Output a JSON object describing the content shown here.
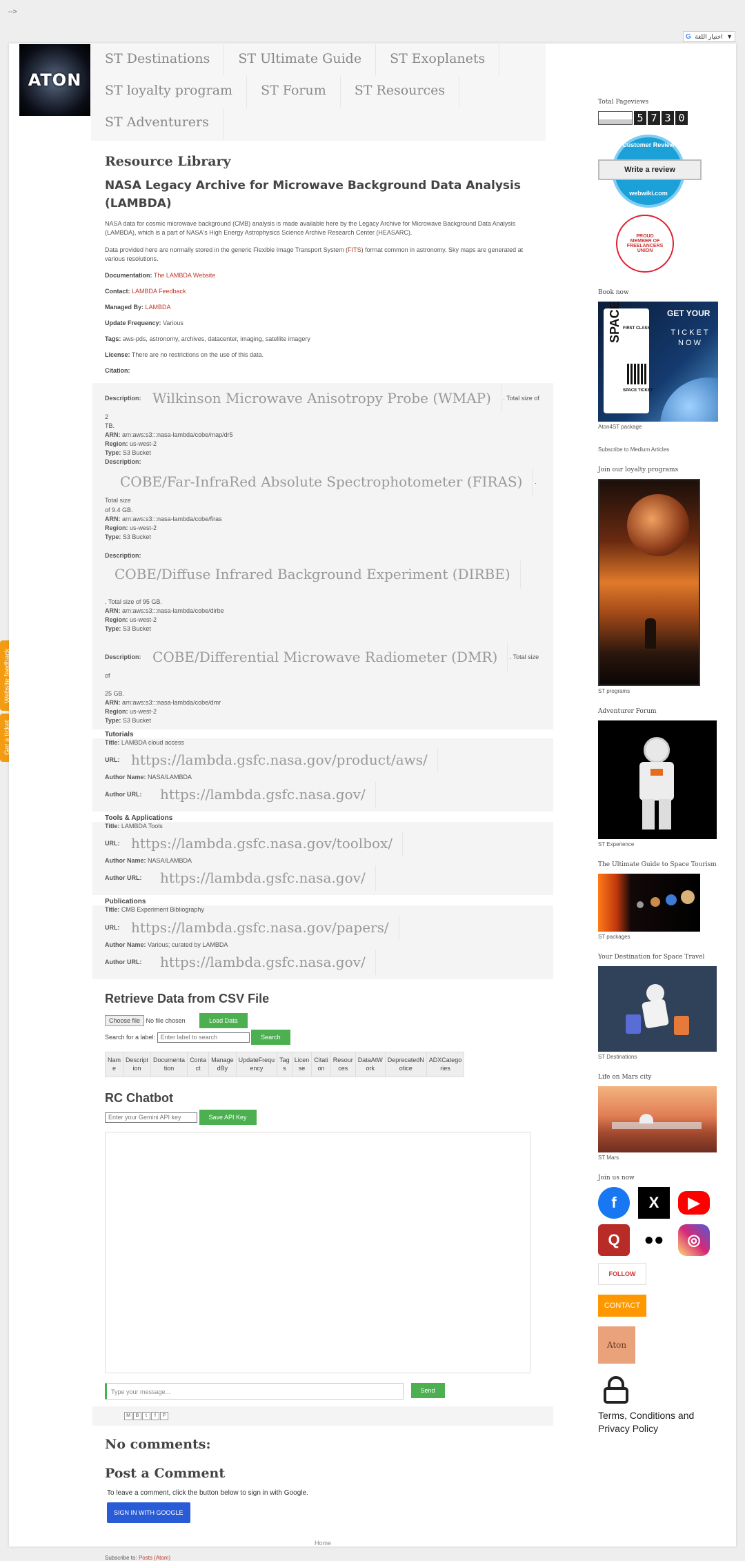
{
  "topbar": {
    "arrow": "-->",
    "translate_label": "اختيار اللغة",
    "translate_caret": "▼",
    "translate_g": "G"
  },
  "logo": {
    "text": "ATON"
  },
  "nav": [
    "ST Destinations",
    "ST Ultimate Guide",
    "ST Exoplanets",
    "ST loyalty program",
    "ST Forum",
    "ST Resources",
    "ST Adventurers"
  ],
  "main": {
    "library_title": "Resource Library",
    "dataset_title": "NASA Legacy Archive for Microwave Background Data Analysis (LAMBDA)",
    "para1": "NASA data for cosmic microwave background (CMB) analysis is made available here by the Legacy Archive for Microwave Background Data Analysis (LAMBDA), which is a part of NASA's High Energy Astrophysics Science Archive Research Center (HEASARC).",
    "para2_a": "Data provided here are normally stored in the generic Flexible Image Transport System (",
    "para2_link": "FITS",
    "para2_b": ") format common in astronomy. Sky maps are generated at various resolutions.",
    "documentation_label": "Documentation:",
    "documentation_value": "The LAMBDA Website",
    "contact_label": "Contact:",
    "contact_value": "LAMBDA Feedback",
    "managed_label": "Managed By:",
    "managed_value": "LAMBDA",
    "frequency_label": "Update Frequency:",
    "frequency_value": "Various",
    "tags_label": "Tags:",
    "tags_value": "aws-pds, astronomy, archives, datacenter, imaging, satellite imagery",
    "license_label": "License:",
    "license_value": "There are no restrictions on the use of this data.",
    "citation_label": "Citation:"
  },
  "resources": [
    {
      "desc_label": "Description:",
      "title": "Wilkinson Microwave Anisotropy Probe (WMAP)",
      "size_a": ". Total size of 2",
      "size_b": "TB.",
      "arn_label": "ARN:",
      "arn": "arn:aws:s3:::nasa-lambda/cobe/map/dr5",
      "region_label": "Region:",
      "region": "us-west-2",
      "type_label": "Type:",
      "type": "S3 Bucket"
    },
    {
      "desc_label": "Description:",
      "title": "COBE/Far-InfraRed Absolute Spectrophotometer (FIRAS)",
      "size_a": ". Total size",
      "size_b": "of 9.4 GB.",
      "arn_label": "ARN:",
      "arn": "arn:aws:s3:::nasa-lambda/cobe/firas",
      "region_label": "Region:",
      "region": "us-west-2",
      "type_label": "Type:",
      "type": "S3 Bucket"
    },
    {
      "desc_label": "Description:",
      "title": "COBE/Diffuse Infrared Background Experiment (DIRBE)",
      "size_a": "",
      "size_b": ". Total size of 95 GB.",
      "arn_label": "ARN:",
      "arn": "arn:aws:s3:::nasa-lambda/cobe/dirbe",
      "region_label": "Region:",
      "region": "us-west-2",
      "type_label": "Type:",
      "type": "S3 Bucket"
    },
    {
      "desc_label": "Description:",
      "title": "COBE/Differential Microwave Radiometer (DMR)",
      "size_a": ". Total size of",
      "size_b": "25 GB.",
      "arn_label": "ARN:",
      "arn": "arn:aws:s3:::nasa-lambda/cobe/dmr",
      "region_label": "Region:",
      "region": "us-west-2",
      "type_label": "Type:",
      "type": "S3 Bucket"
    }
  ],
  "sections": [
    {
      "heading": "Tutorials",
      "title_label": "Title:",
      "title": "LAMBDA cloud access",
      "url_label": "URL:",
      "url": "https://lambda.gsfc.nasa.gov/product/aws/",
      "author_label": "Author Name:",
      "author": "NASA/LAMBDA",
      "author_url_label": "Author URL:",
      "author_url": "https://lambda.gsfc.nasa.gov/"
    },
    {
      "heading": "Tools & Applications",
      "title_label": "Title:",
      "title": "LAMBDA Tools",
      "url_label": "URL:",
      "url": "https://lambda.gsfc.nasa.gov/toolbox/",
      "author_label": "Author Name:",
      "author": "NASA/LAMBDA",
      "author_url_label": "Author URL:",
      "author_url": "https://lambda.gsfc.nasa.gov/"
    },
    {
      "heading": "Publications",
      "title_label": "Title:",
      "title": "CMB Experiment Bibliography",
      "url_label": "URL:",
      "url": "https://lambda.gsfc.nasa.gov/papers/",
      "author_label": "Author Name:",
      "author": "Various; curated by LAMBDA",
      "author_url_label": "Author URL:",
      "author_url": "https://lambda.gsfc.nasa.gov/"
    }
  ],
  "csv": {
    "title": "Retrieve Data from CSV File",
    "choose_file": "Choose file",
    "no_file": "No file chosen",
    "load_button": "Load Data",
    "search_label": "Search for a label:",
    "search_placeholder": "Enter label to search",
    "search_button": "Search",
    "columns": [
      [
        "Nam",
        "e"
      ],
      [
        "Descript",
        "ion"
      ],
      [
        "Documenta",
        "tion"
      ],
      [
        "Conta",
        "ct"
      ],
      [
        "Manage",
        "dBy"
      ],
      [
        "UpdateFrequ",
        "ency"
      ],
      [
        "Tag",
        "s"
      ],
      [
        "Licen",
        "se"
      ],
      [
        "Citati",
        "on"
      ],
      [
        "Resour",
        "ces"
      ],
      [
        "DataAtW",
        "ork"
      ],
      [
        "DeprecatedN",
        "otice"
      ],
      [
        "ADXCatego",
        "ries"
      ]
    ]
  },
  "chatbot": {
    "title": "RC Chatbot",
    "api_placeholder": "Enter your Gemini API key",
    "save_button": "Save API Key",
    "message_placeholder": "Type your message...",
    "send_button": "Send"
  },
  "share": [
    "M",
    "B",
    "t",
    "f",
    "P"
  ],
  "comments": {
    "no_comments": "No comments:",
    "post_title": "Post a Comment",
    "instruction": "To leave a comment, click the button below to sign in with Google.",
    "google_button": "SIGN IN WITH GOOGLE",
    "home": "Home",
    "subscribe_label": "Subscribe to:",
    "subscribe_link": "Posts (Atom)"
  },
  "sidebar": {
    "pageviews_title": "Total Pageviews",
    "digits": [
      "5",
      "7",
      "3",
      "0"
    ],
    "review_top": "Customer Review",
    "review_mid": "Write a review",
    "review_bottom": "webwiki.com",
    "union_text": "PROUD MEMBER OF FREELANCERS UNION",
    "book_title": "Book now",
    "ticket_get": "GET YOUR",
    "ticket_word": "TICKET NOW",
    "ticket_space": "SPACE",
    "ticket_first": "FIRST CLASS",
    "ticket_label": "SPACE TICKET",
    "book_caption": "Aton4ST package",
    "subscribe_medium": "Subscribe to Medium Articles",
    "loyalty_title": "Join our loyalty programs",
    "loyalty_caption": "ST programs",
    "forum_title": "Adventurer Forum",
    "forum_caption": "ST Experience",
    "guide_title": "The Ultimate Guide to Space Tourism",
    "guide_caption": "ST packages",
    "dest_title": "Your Destination for Space Travel",
    "dest_caption": "ST Destinations",
    "mars_title": "Life on Mars city",
    "mars_caption": "ST Mars",
    "join_title": "Join us now",
    "social": [
      "f",
      "X",
      "▶",
      "Q",
      "●●",
      "◎"
    ],
    "follow": "FOLLOW",
    "contact": "CONTACT",
    "aton_badge": "Aton",
    "terms": "Terms, Conditions and Privacy Policy"
  },
  "side_tabs": {
    "feedback": "Website feedback",
    "ticket": "Get a ticket"
  }
}
